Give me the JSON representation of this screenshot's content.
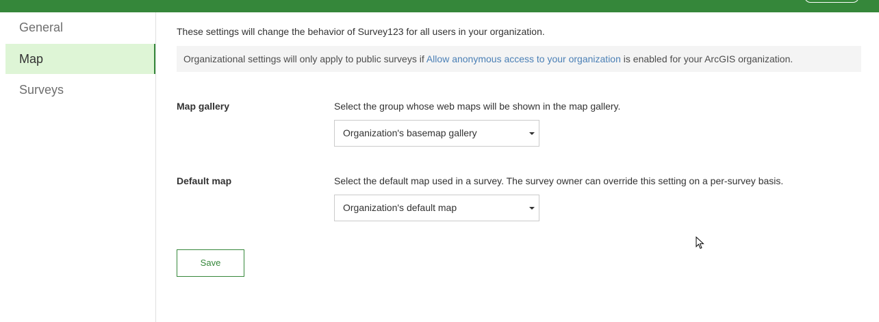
{
  "sidebar": {
    "items": [
      {
        "label": "General"
      },
      {
        "label": "Map"
      },
      {
        "label": "Surveys"
      }
    ],
    "active": "Map"
  },
  "main": {
    "intro": "These settings will change the behavior of Survey123 for all users in your organization.",
    "notice": {
      "before": "Organizational settings will only apply to public surveys if ",
      "link": "Allow anonymous access to your organization",
      "after": " is enabled for your ArcGIS organization."
    },
    "map_gallery": {
      "label": "Map gallery",
      "description": "Select the group whose web maps will be shown in the map gallery.",
      "selected": "Organization's basemap gallery"
    },
    "default_map": {
      "label": "Default map",
      "description": "Select the default map used in a survey. The survey owner can override this setting on a per-survey basis.",
      "selected": "Organization's default map"
    },
    "save_label": "Save"
  },
  "colors": {
    "brand": "#35873a",
    "active_bg": "#def5d6",
    "link": "#4a7fb5"
  }
}
